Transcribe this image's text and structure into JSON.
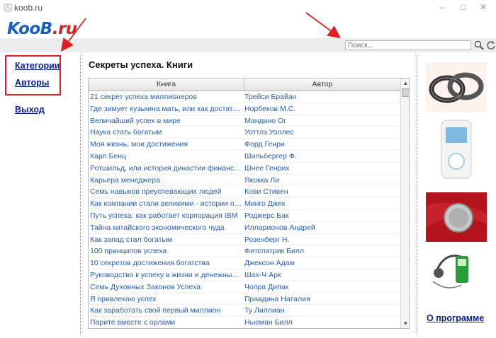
{
  "window": {
    "title": "koob.ru"
  },
  "logo": {
    "text_main": "KooB",
    "text_dot": ".ru"
  },
  "search": {
    "placeholder": "Поиск..."
  },
  "nav": {
    "categories": "Категории",
    "authors": "Авторы",
    "exit": "Выход"
  },
  "main": {
    "title": "Секреты успеха. Книги",
    "columns": {
      "book": "Книга",
      "author": "Автор"
    },
    "rows": [
      {
        "book": "21 секрет успеха миллионеров",
        "author": "Трейси Брайан"
      },
      {
        "book": "Где зимует кузькина мать, или как достать x...",
        "author": "Норбеков М.С."
      },
      {
        "book": "Величайший успех в мире",
        "author": "Мандино Ог"
      },
      {
        "book": "Наука стать богатым",
        "author": "Уоттлз Уоллес"
      },
      {
        "book": "Моя жизнь, мои достижения",
        "author": "Форд Генри"
      },
      {
        "book": "Карл Бенц",
        "author": "Шильбергер Ф."
      },
      {
        "book": "Ротшильд, или история династии финансов...",
        "author": "Шнее Генрих"
      },
      {
        "book": "Карьера менеджера",
        "author": "Якокка Ли"
      },
      {
        "book": "Семь навыков преуспевающих людей",
        "author": "Кови Стивен"
      },
      {
        "book": "Как компании стали великими - истории о би...",
        "author": "Минго Джек"
      },
      {
        "book": "Путь успеха: как работает корпорация IBM",
        "author": "Роджерс Бак"
      },
      {
        "book": "Тайна китайского экономического чуда",
        "author": "Илларионов Андрей"
      },
      {
        "book": "Как запад стал богатым",
        "author": "Розенберг Н."
      },
      {
        "book": "100 принципов успеха",
        "author": "Фитспатрик Билл"
      },
      {
        "book": "10 секретов достижения богатства",
        "author": "Джексон Адам"
      },
      {
        "book": "Руководство к успеху в жизни и денежных де...",
        "author": "Шах-Ч Арк"
      },
      {
        "book": "Семь Духовных Законов Успеха",
        "author": "Чопра Дипак"
      },
      {
        "book": "Я привлекаю успех",
        "author": "Правдина Наталия"
      },
      {
        "book": "Как заработать свой первый миллион",
        "author": "Ту Лиллиан"
      },
      {
        "book": "Парите вместе с орлами",
        "author": "Ньюман Билл"
      }
    ]
  },
  "sidebar": {
    "about": "О программе"
  },
  "colors": {
    "accent": "#1a5fbf",
    "link": "#0b1f8c",
    "cell_text": "#2a5fa8",
    "annotation": "#e02020"
  }
}
